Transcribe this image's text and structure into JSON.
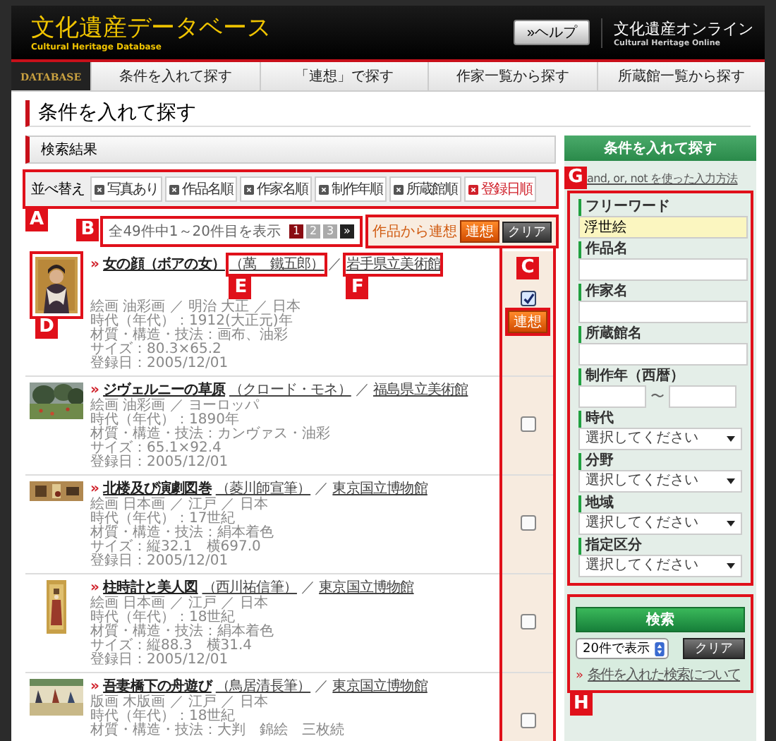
{
  "header": {
    "logo": "文化遺産データベース",
    "logo_sub": "Cultural Heritage Database",
    "help_button": "»ヘルプ",
    "site_name": "文化遺産オンライン",
    "site_sub": "Cultural Heritage Online"
  },
  "nav": {
    "brand": "DATABASE",
    "tabs": [
      "条件を入れて探す",
      "「連想」で探す",
      "作家一覧から探す",
      "所蔵館一覧から探す"
    ]
  },
  "page_title": "条件を入れて探す",
  "results": {
    "heading": "検索結果",
    "title_marker": "»",
    "separator": "／",
    "sort": {
      "label": "並べ替え",
      "callout": "A",
      "options": [
        {
          "label": "写真あり",
          "selected": false
        },
        {
          "label": "作品名順",
          "selected": false
        },
        {
          "label": "作家名順",
          "selected": false
        },
        {
          "label": "制作年順",
          "selected": false
        },
        {
          "label": "所蔵館順",
          "selected": false
        },
        {
          "label": "登録日順",
          "selected": true
        }
      ]
    },
    "pager": {
      "callout": "B",
      "summary": "全49件中1～20件目を表示",
      "pages": [
        {
          "label": "1",
          "selected": true
        },
        {
          "label": "2",
          "selected": false
        },
        {
          "label": "3",
          "selected": false
        }
      ],
      "next": "»"
    },
    "related": {
      "callout": "C",
      "label": "作品から連想",
      "related_button": "連想",
      "clear_button": "クリア"
    },
    "rows": [
      {
        "title": "女の顔（ボアの女）",
        "artist": "（萬　鐵五郎）",
        "museum": "岩手県立美術館",
        "thumbnail_callout": "D",
        "artist_callout": "E",
        "museum_callout": "F",
        "checked": true,
        "related_button": "連想",
        "details": [
          "絵画 油彩画 ／ 明治 大正 ／ 日本",
          "時代（年代）：1912(大正元)年",
          "材質・構造・技法：画布、油彩",
          "サイズ：80.3×65.2",
          "登録日：2005/12/01"
        ]
      },
      {
        "title": "ジヴェルニーの草原",
        "artist": "（クロード・モネ）",
        "museum": "福島県立美術館",
        "checked": false,
        "details": [
          "絵画 油彩画 ／ ヨーロッパ",
          "時代（年代）：1890年",
          "材質・構造・技法：カンヴァス・油彩",
          "サイズ：65.1×92.4",
          "登録日：2005/12/01"
        ]
      },
      {
        "title": "北楼及び演劇図巻",
        "artist": "（菱川師宣筆）",
        "museum": "東京国立博物館",
        "checked": false,
        "details": [
          "絵画 日本画 ／ 江戸 ／ 日本",
          "時代（年代）：17世紀",
          "材質・構造・技法：絹本着色",
          "サイズ：縦32.1　横697.0",
          "登録日：2005/12/01"
        ]
      },
      {
        "title": "柱時計と美人図",
        "artist": "（西川祐信筆）",
        "museum": "東京国立博物館",
        "checked": false,
        "details": [
          "絵画 日本画 ／ 江戸 ／ 日本",
          "時代（年代）：18世紀",
          "材質・構造・技法：絹本着色",
          "サイズ：縦88.3　横31.4",
          "登録日：2005/12/01"
        ]
      },
      {
        "title": "吾妻橋下の舟遊び",
        "artist": "（鳥居清長筆）",
        "museum": "東京国立博物館",
        "checked": false,
        "details": [
          "版画 木版画 ／ 江戸 ／ 日本",
          "時代（年代）：18世紀",
          "材質・構造・技法：大判　錦絵　三枚続"
        ]
      }
    ]
  },
  "sidebar": {
    "heading": "条件を入れて探す",
    "help_link": "and, or, not を使った入力方法",
    "callout": "G",
    "fields": [
      {
        "kind": "text",
        "label": "フリーワード",
        "value": "浮世絵"
      },
      {
        "kind": "text",
        "label": "作品名"
      },
      {
        "kind": "text",
        "label": "作家名"
      },
      {
        "kind": "text",
        "label": "所蔵館名"
      },
      {
        "kind": "range",
        "label": "制作年（西暦）",
        "separator": "〜"
      },
      {
        "kind": "select",
        "label": "時代",
        "value": "選択してください"
      },
      {
        "kind": "select",
        "label": "分野",
        "value": "選択してください"
      },
      {
        "kind": "select",
        "label": "地域",
        "value": "選択してください"
      },
      {
        "kind": "select",
        "label": "指定区分",
        "value": "選択してください"
      }
    ],
    "actions": {
      "callout": "H",
      "search_button": "検索",
      "per_page": "20件で表示",
      "clear_button": "クリア",
      "link_marker": "»",
      "help_link": "条件を入れた検索について"
    }
  }
}
